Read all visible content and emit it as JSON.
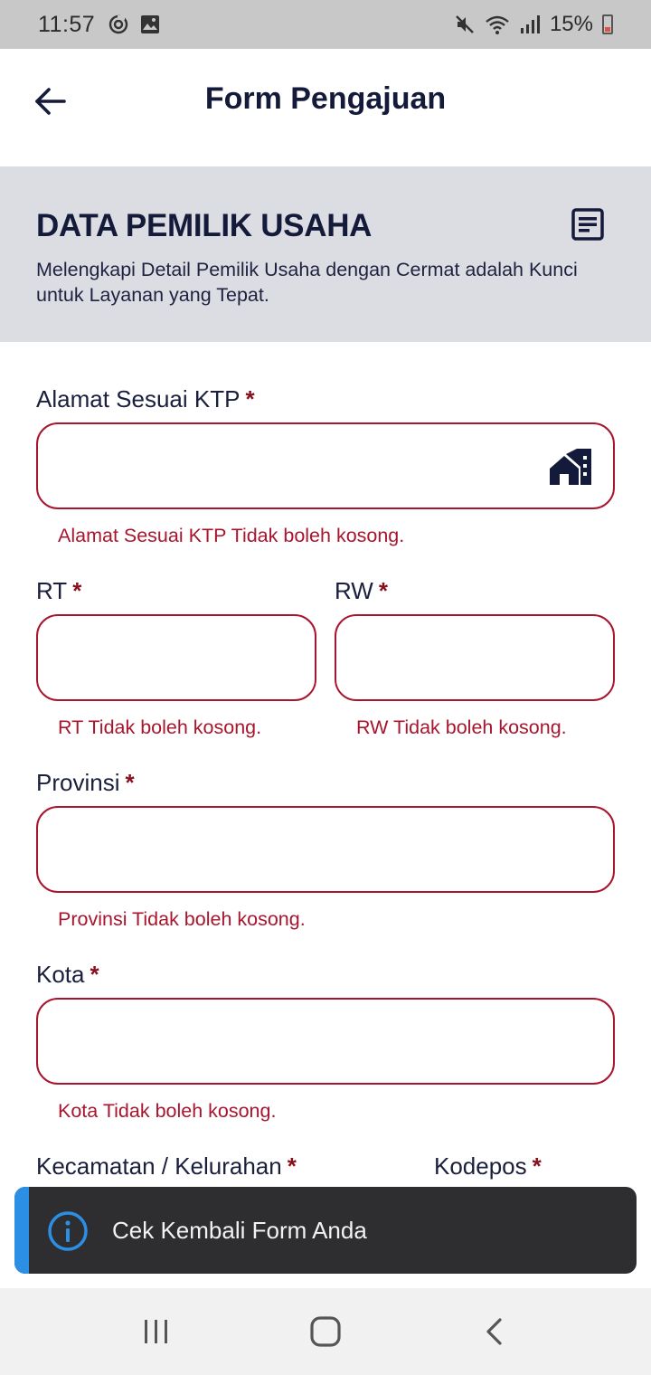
{
  "status_bar": {
    "time": "11:57",
    "battery_text": "15%",
    "icons": [
      "sync-icon",
      "image-icon",
      "mute-icon",
      "wifi-icon",
      "signal-icon",
      "battery-icon"
    ]
  },
  "header": {
    "title": "Form Pengajuan",
    "back_icon": "arrow-left-icon"
  },
  "section": {
    "title": "DATA PEMILIK USAHA",
    "description": "Melengkapi Detail Pemilik Usaha dengan Cermat adalah Kunci untuk Layanan yang Tepat.",
    "icon": "form-document-icon"
  },
  "form": {
    "required_marker": "*",
    "alamat": {
      "label": "Alamat Sesuai KTP",
      "value": "",
      "error": "Alamat Sesuai KTP Tidak boleh kosong.",
      "icon": "house-building-icon"
    },
    "rt": {
      "label": "RT",
      "value": "",
      "error": "RT Tidak boleh kosong."
    },
    "rw": {
      "label": "RW",
      "value": "",
      "error": "RW Tidak boleh kosong."
    },
    "provinsi": {
      "label": "Provinsi",
      "value": "",
      "error": "Provinsi Tidak boleh kosong."
    },
    "kota": {
      "label": "Kota",
      "value": "",
      "error": "Kota Tidak boleh kosong."
    },
    "kecamatan": {
      "label": "Kecamatan / Kelurahan"
    },
    "kodepos": {
      "label": "Kodepos"
    }
  },
  "toast": {
    "message": "Cek Kembali Form Anda",
    "icon": "info-circle-icon"
  },
  "nav_bar": {
    "icons": [
      "recent-apps-icon",
      "home-icon",
      "back-icon"
    ]
  },
  "colors": {
    "primary": "#141a3a",
    "error": "#a8152e",
    "banner_bg": "#dcdde2",
    "toast_bg": "#2e2e30",
    "toast_accent": "#2b8fe6"
  }
}
